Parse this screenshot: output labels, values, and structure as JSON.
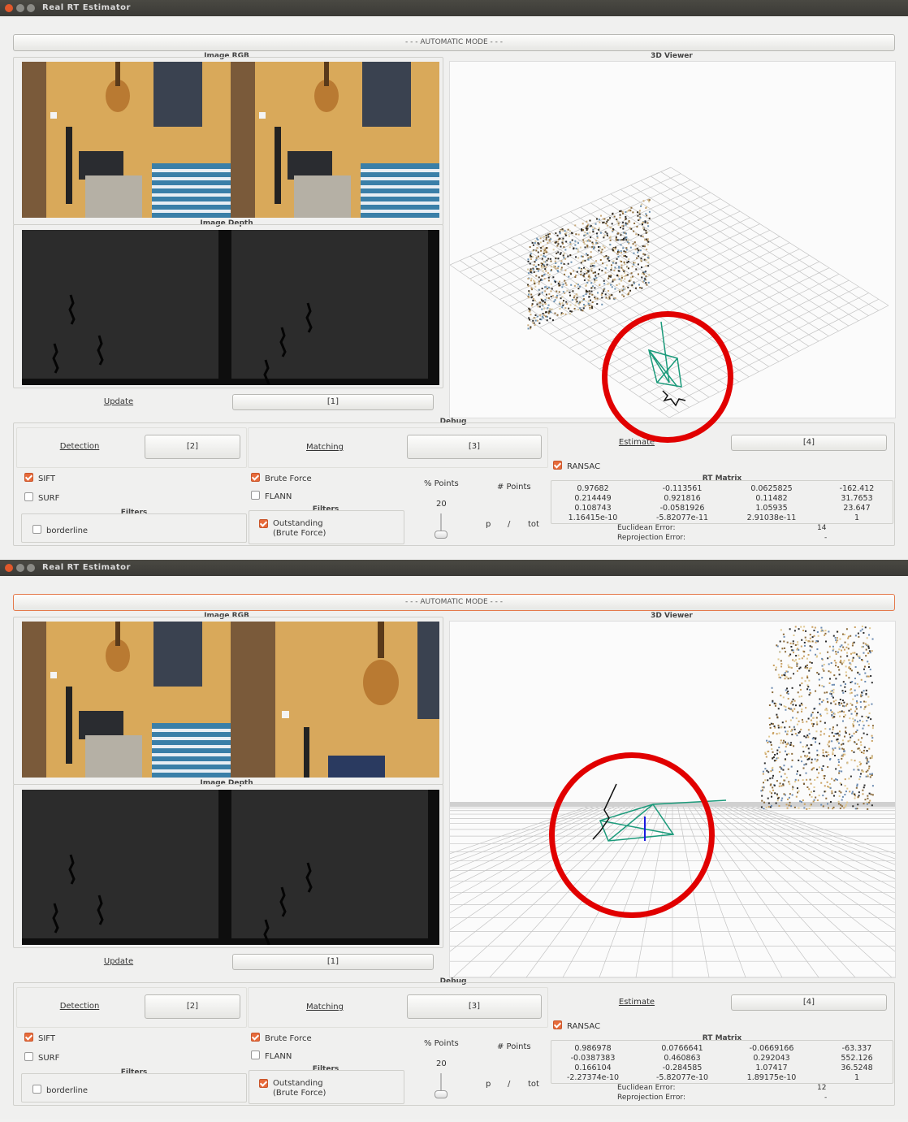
{
  "windows": [
    {
      "title": "Real RT Estimator",
      "mode_label": "- - - AUTOMATIC MODE - - -",
      "image_rgb_title": "Image RGB",
      "image_depth_title": "Image Depth",
      "viewer_title": "3D Viewer",
      "update_label": "Update",
      "update_button": "[1]",
      "debug_title": "Debug",
      "detection_label": "Detection",
      "detection_button": "[2]",
      "matching_label": "Matching",
      "matching_button": "[3]",
      "estimate_label": "Estimate",
      "estimate_button": "[4]",
      "sift": "SIFT",
      "surf": "SURF",
      "filters": "Filters",
      "borderline": "borderline",
      "brute_force": "Brute Force",
      "flann": "FLANN",
      "outstanding_1": "Outstanding",
      "outstanding_2": "(Brute Force)",
      "pct_points": "% Points",
      "num_points": "# Points",
      "slider_value": "20",
      "p": "p",
      "slash": "/",
      "tot": "tot",
      "ransac": "RANSAC",
      "rt_matrix_title": "RT Matrix",
      "rt_matrix": [
        [
          "0.97682",
          "-0.113561",
          "0.0625825",
          "-162.412"
        ],
        [
          "0.214449",
          "0.921816",
          "0.11482",
          "31.7653"
        ],
        [
          "0.108743",
          "-0.0581926",
          "1.05935",
          "23.647"
        ],
        [
          "1.16415e-10",
          "-5.82077e-11",
          "2.91038e-11",
          "1"
        ]
      ],
      "euclidean_label": "Euclidean Error:",
      "euclidean_value": "14",
      "reprojection_label": "Reprojection Error:",
      "reprojection_value": "-"
    },
    {
      "title": "Real RT Estimator",
      "mode_label": "- - - AUTOMATIC MODE - - -",
      "image_rgb_title": "Image RGB",
      "image_depth_title": "Image Depth",
      "viewer_title": "3D Viewer",
      "update_label": "Update",
      "update_button": "[1]",
      "debug_title": "Debug",
      "detection_label": "Detection",
      "detection_button": "[2]",
      "matching_label": "Matching",
      "matching_button": "[3]",
      "estimate_label": "Estimate",
      "estimate_button": "[4]",
      "sift": "SIFT",
      "surf": "SURF",
      "filters": "Filters",
      "borderline": "borderline",
      "brute_force": "Brute Force",
      "flann": "FLANN",
      "outstanding_1": "Outstanding",
      "outstanding_2": "(Brute Force)",
      "pct_points": "% Points",
      "num_points": "# Points",
      "slider_value": "20",
      "p": "p",
      "slash": "/",
      "tot": "tot",
      "ransac": "RANSAC",
      "rt_matrix_title": "RT Matrix",
      "rt_matrix": [
        [
          "0.986978",
          "0.0766641",
          "-0.0669166",
          "-63.337"
        ],
        [
          "-0.0387383",
          "0.460863",
          "0.292043",
          "552.126"
        ],
        [
          "0.166104",
          "-0.284585",
          "1.07417",
          "36.5248"
        ],
        [
          "-2.27374e-10",
          "-5.82077e-10",
          "1.89175e-10",
          "1"
        ]
      ],
      "euclidean_label": "Euclidean Error:",
      "euclidean_value": "12",
      "reprojection_label": "Reprojection Error:",
      "reprojection_value": "-"
    }
  ],
  "checkbox_state": {
    "sift": true,
    "surf": false,
    "borderline": false,
    "brute_force": true,
    "flann": false,
    "outstanding": true,
    "ransac": true
  },
  "colors": {
    "accent": "#e76b3b",
    "annotation_circle": "#e10000",
    "camera_pose": "#1a9a7a"
  }
}
